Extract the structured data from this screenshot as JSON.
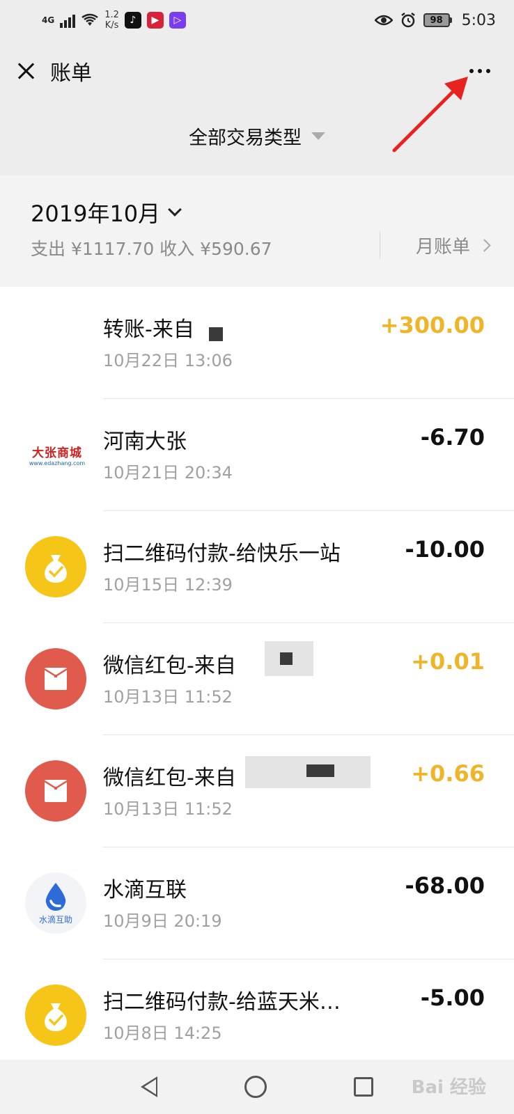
{
  "status_bar": {
    "network": "4G",
    "speed_value": "1.2",
    "speed_unit": "K/s",
    "battery": "98",
    "time": "5:03"
  },
  "header": {
    "title": "账单"
  },
  "filter": {
    "label": "全部交易类型"
  },
  "month": {
    "label": "2019年10月",
    "summary": "支出 ¥1117.70 收入 ¥590.67",
    "monthly_bill_label": "月账单"
  },
  "transactions": [
    {
      "name": "转账-来自",
      "time": "10月22日 13:06",
      "amount": "+300.00",
      "type": "income"
    },
    {
      "name": "河南大张",
      "time": "10月21日 20:34",
      "amount": "-6.70",
      "type": "expense",
      "logo_title": "大张商城",
      "logo_url": "www.edazhang.com"
    },
    {
      "name": "扫二维码付款-给快乐一站",
      "time": "10月15日 12:39",
      "amount": "-10.00",
      "type": "expense"
    },
    {
      "name": "微信红包-来自",
      "time": "10月13日 11:52",
      "amount": "+0.01",
      "type": "income"
    },
    {
      "name": "微信红包-来自",
      "time": "10月13日 11:52",
      "amount": "+0.66",
      "type": "income"
    },
    {
      "name": "水滴互联",
      "time": "10月9日 20:19",
      "amount": "-68.00",
      "type": "expense",
      "logo_caption": "水滴互助"
    },
    {
      "name": "扫二维码付款-给蓝天米…",
      "time": "10月8日 14:25",
      "amount": "-5.00",
      "type": "expense"
    }
  ],
  "colors": {
    "income": "#f0b428",
    "expense": "#111111",
    "background": "#ededed",
    "annotation": "#e8231f"
  },
  "watermark": "Bai 经验"
}
